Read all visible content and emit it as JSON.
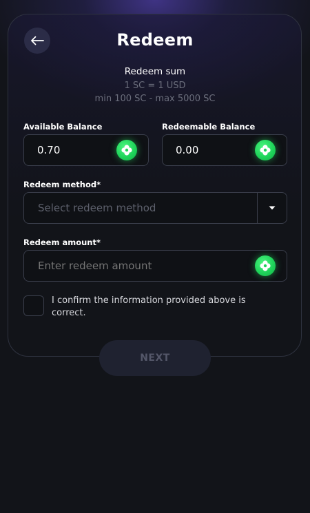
{
  "header": {
    "title": "Redeem",
    "back_icon": "arrow-left-icon"
  },
  "summary": {
    "heading": "Redeem sum",
    "rate": "1 SC = 1 USD",
    "limits": "min 100 SC - max 5000 SC"
  },
  "available_balance": {
    "label": "Available Balance",
    "value": "0.70",
    "icon": "sweep-coin-icon"
  },
  "redeemable_balance": {
    "label": "Redeemable Balance",
    "value": "0.00",
    "icon": "sweep-coin-icon"
  },
  "redeem_method": {
    "label": "Redeem method*",
    "placeholder": "Select redeem method",
    "icon": "caret-down-icon"
  },
  "redeem_amount": {
    "label": "Redeem amount*",
    "placeholder": "Enter redeem amount",
    "icon": "sweep-coin-icon"
  },
  "confirm": {
    "text": "I confirm the information provided above is correct.",
    "checked": false
  },
  "next_button": {
    "label": "NEXT",
    "enabled": false
  },
  "colors": {
    "background": "#121419",
    "accent_green": "#1fd45a",
    "placeholder_text": "#5d606c",
    "border": "#3a3e4b"
  }
}
